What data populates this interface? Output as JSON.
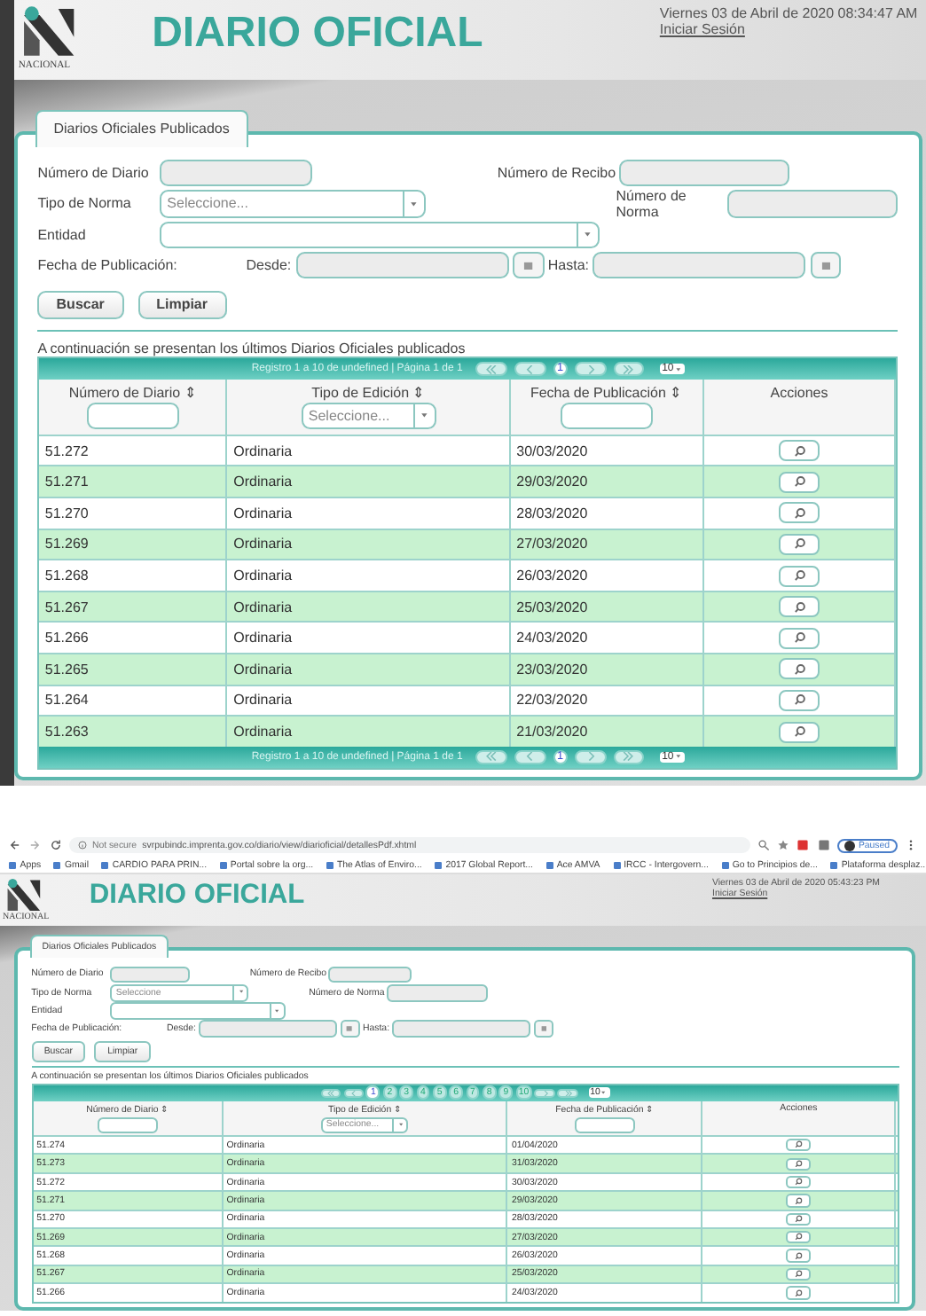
{
  "screens": [
    {
      "header": {
        "logo_text": "NACIONAL",
        "title": "DIARIO OFICIAL",
        "datetime": "Viernes 03 de Abril de 2020 08:34:47 AM",
        "login": "Iniciar Sesión"
      },
      "tab": "Diarios Oficiales Publicados",
      "form": {
        "numero_diario": "Número de Diario",
        "numero_recibo": "Número de Recibo",
        "tipo_norma": "Tipo de Norma",
        "tipo_norma_value": "Seleccione...",
        "numero_norma": "Número de Norma",
        "entidad": "Entidad",
        "fecha": "Fecha de Publicación:",
        "desde": "Desde:",
        "hasta": "Hasta:"
      },
      "buttons": [
        "Buscar",
        "Limpiar"
      ],
      "caption": "A continuación se presentan los últimos Diarios Oficiales publicados",
      "pager": {
        "text": "Registro 1 a 10 de undefined | Página 1 de 1",
        "pages": [
          {
            "label": "1",
            "selected": true
          }
        ],
        "page_size": "10"
      },
      "columns": [
        {
          "label": "Número de Diario ⇕",
          "kind": "text"
        },
        {
          "label": "Tipo de Edición ⇕",
          "kind": "select",
          "value": "Seleccione..."
        },
        {
          "label": "Fecha de Publicación ⇕",
          "kind": "text"
        },
        {
          "label": "Acciones",
          "kind": "none"
        }
      ],
      "rows": [
        [
          "51.272",
          "Ordinaria",
          "30/03/2020"
        ],
        [
          "51.271",
          "Ordinaria",
          "29/03/2020"
        ],
        [
          "51.270",
          "Ordinaria",
          "28/03/2020"
        ],
        [
          "51.269",
          "Ordinaria",
          "27/03/2020"
        ],
        [
          "51.268",
          "Ordinaria",
          "26/03/2020"
        ],
        [
          "51.267",
          "Ordinaria",
          "25/03/2020"
        ],
        [
          "51.266",
          "Ordinaria",
          "24/03/2020"
        ],
        [
          "51.265",
          "Ordinaria",
          "23/03/2020"
        ],
        [
          "51.264",
          "Ordinaria",
          "22/03/2020"
        ],
        [
          "51.263",
          "Ordinaria",
          "21/03/2020"
        ]
      ],
      "footer_pager": {
        "text": "Registro 1 a 10 de undefined | Página 1 de 1",
        "pages": [
          {
            "label": "1",
            "selected": true
          }
        ],
        "page_size": "10"
      }
    },
    {
      "browser": {
        "security": "Not secure",
        "url": "svrpubindc.imprenta.gov.co/diario/view/diarioficial/detallesPdf.xhtml",
        "profile": "Paused",
        "bookmarks": [
          "Apps",
          "Gmail",
          "CARDIO PARA PRIN...",
          "Portal sobre la org...",
          "The Atlas of Enviro...",
          "2017 Global Report...",
          "Ace AMVA",
          "IRCC - Intergovern...",
          "Go to Principios de...",
          "Plataforma desplaz..."
        ]
      },
      "header": {
        "logo_text": "NACIONAL",
        "title": "DIARIO OFICIAL",
        "datetime": "Viernes 03 de Abril de 2020 05:43:23 PM",
        "login": "Iniciar Sesión"
      },
      "tab": "Diarios Oficiales Publicados",
      "form": {
        "numero_diario": "Número de Diario",
        "numero_recibo": "Número de Recibo",
        "tipo_norma": "Tipo de Norma",
        "tipo_norma_value": "Seleccione",
        "numero_norma": "Número de Norma",
        "entidad": "Entidad",
        "fecha": "Fecha de Publicación:",
        "desde": "Desde:",
        "hasta": "Hasta:"
      },
      "buttons": [
        "Buscar",
        "Limpiar"
      ],
      "caption": "A continuación se presentan los últimos Diarios Oficiales publicados",
      "pager": {
        "pages": [
          {
            "label": "1",
            "selected": true
          },
          {
            "label": "2",
            "selected": false
          },
          {
            "label": "3",
            "selected": false
          },
          {
            "label": "4",
            "selected": false
          },
          {
            "label": "5",
            "selected": false
          },
          {
            "label": "6",
            "selected": false
          },
          {
            "label": "7",
            "selected": false
          },
          {
            "label": "8",
            "selected": false
          },
          {
            "label": "9",
            "selected": false
          },
          {
            "label": "10",
            "selected": false
          }
        ],
        "page_size": "10"
      },
      "columns": [
        {
          "label": "Número de Diario ⇕",
          "kind": "text"
        },
        {
          "label": "Tipo de Edición ⇕",
          "kind": "select",
          "value": "Seleccione..."
        },
        {
          "label": "Fecha de Publicación ⇕",
          "kind": "text"
        },
        {
          "label": "Acciones",
          "kind": "none"
        }
      ],
      "rows": [
        [
          "51.274",
          "Ordinaria",
          "01/04/2020"
        ],
        [
          "51.273",
          "Ordinaria",
          "31/03/2020"
        ],
        [
          "51.272",
          "Ordinaria",
          "30/03/2020"
        ],
        [
          "51.271",
          "Ordinaria",
          "29/03/2020"
        ],
        [
          "51.270",
          "Ordinaria",
          "28/03/2020"
        ],
        [
          "51.269",
          "Ordinaria",
          "27/03/2020"
        ],
        [
          "51.268",
          "Ordinaria",
          "26/03/2020"
        ],
        [
          "51.267",
          "Ordinaria",
          "25/03/2020"
        ],
        [
          "51.266",
          "Ordinaria",
          "24/03/2020"
        ]
      ]
    }
  ]
}
